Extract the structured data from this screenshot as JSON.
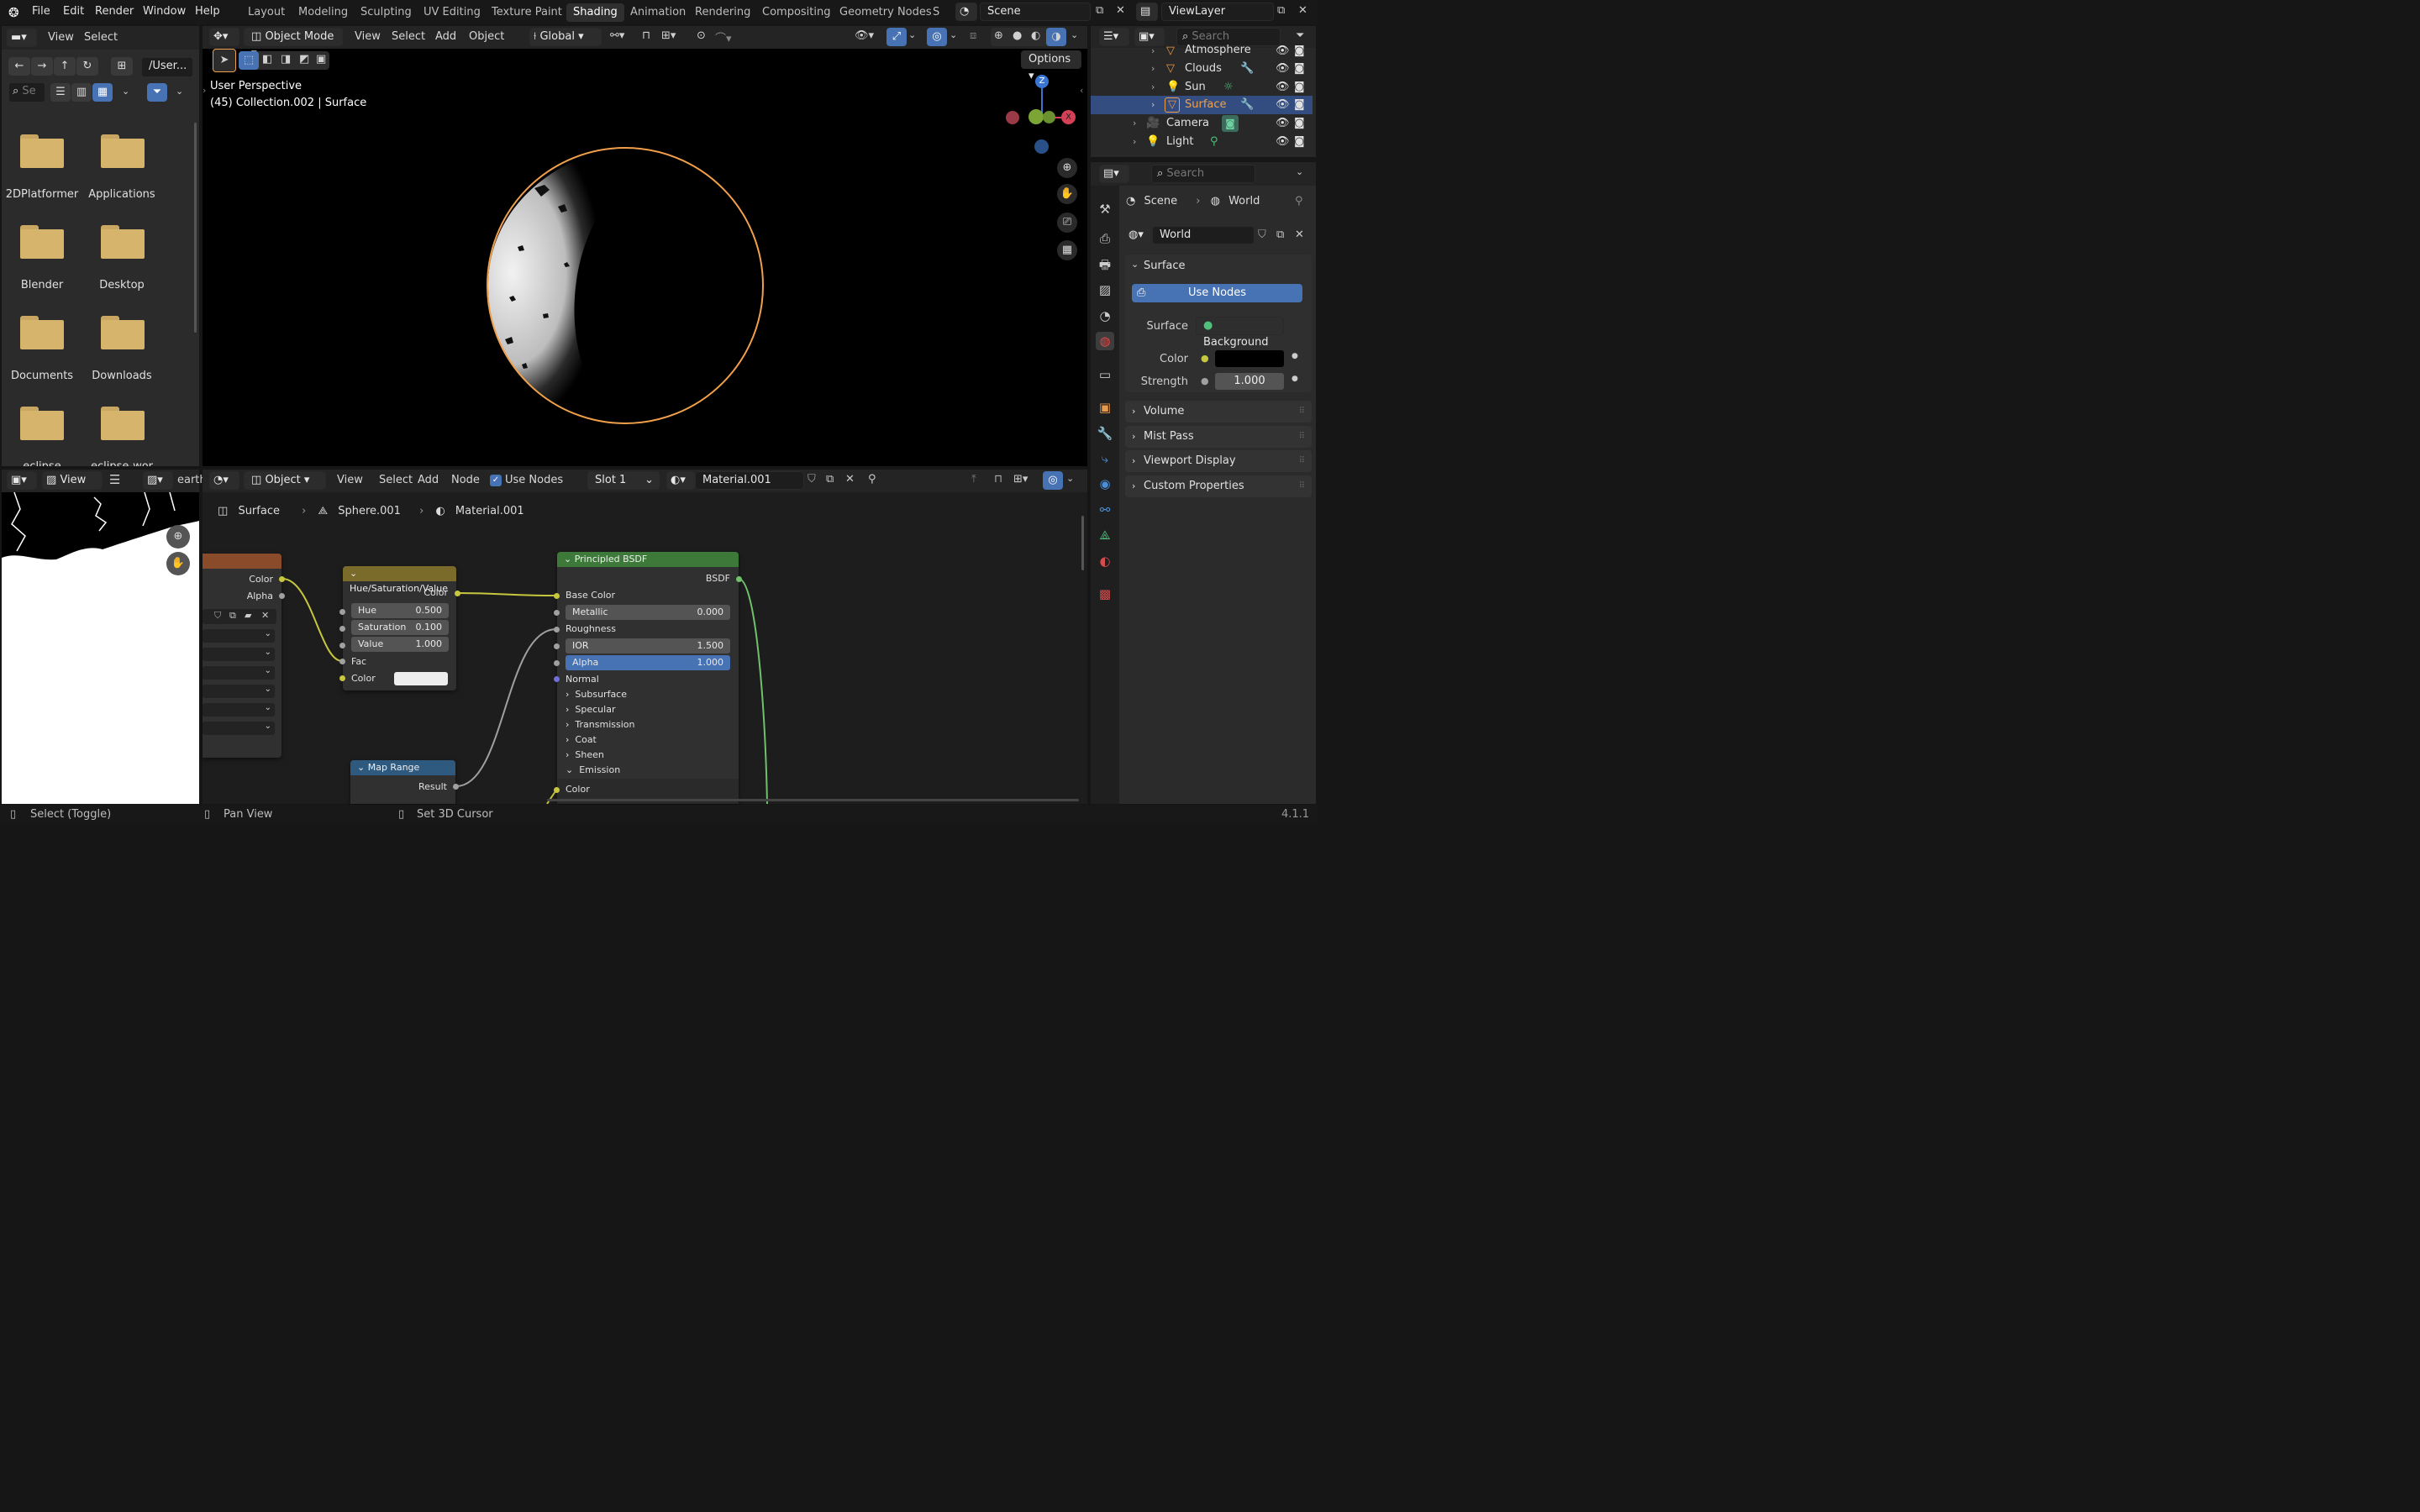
{
  "topbar": {
    "menus": [
      "File",
      "Edit",
      "Render",
      "Window",
      "Help"
    ],
    "workspaces": [
      "Layout",
      "Modeling",
      "Sculpting",
      "UV Editing",
      "Texture Paint",
      "Shading",
      "Animation",
      "Rendering",
      "Compositing",
      "Geometry Nodes",
      "S"
    ],
    "active_workspace": "Shading",
    "scene": "Scene",
    "view_layer": "ViewLayer"
  },
  "file_browser": {
    "menus": [
      "View",
      "Select"
    ],
    "path": "/User...",
    "search_placeholder": "Se",
    "folders": [
      "2DPlatformer",
      "Applications",
      "Blender",
      "Desktop",
      "Documents",
      "Downloads",
      "eclipse",
      "eclipse-wor"
    ]
  },
  "image_editor": {
    "view_label": "View",
    "image_name": "earth"
  },
  "viewport": {
    "mode": "Object Mode",
    "menus": [
      "View",
      "Select",
      "Add",
      "Object"
    ],
    "orientation": "Global",
    "options": "Options",
    "perspective": "User Perspective",
    "collection_info": "(45) Collection.002 | Surface",
    "gizmo": {
      "z": "Z",
      "x": "X"
    }
  },
  "node_editor": {
    "type": "Object",
    "menus": [
      "View",
      "Select",
      "Add",
      "Node"
    ],
    "use_nodes": "Use Nodes",
    "slot": "Slot 1",
    "material": "Material.001",
    "breadcrumb": [
      "Surface",
      "Sphere.001",
      "Material.001"
    ],
    "image_node": {
      "outputs": [
        "Color",
        "Alpha"
      ]
    },
    "hsv_node": {
      "title": "Hue/Saturation/Value",
      "output": "Color",
      "inputs": [
        {
          "label": "Hue",
          "value": "0.500"
        },
        {
          "label": "Saturation",
          "value": "0.100"
        },
        {
          "label": "Value",
          "value": "1.000"
        }
      ],
      "fac": "Fac",
      "color": "Color"
    },
    "bsdf_node": {
      "title": "Principled BSDF",
      "output": "BSDF",
      "base_color": "Base Color",
      "metallic": {
        "label": "Metallic",
        "value": "0.000"
      },
      "roughness": "Roughness",
      "ior": {
        "label": "IOR",
        "value": "1.500"
      },
      "alpha": {
        "label": "Alpha",
        "value": "1.000"
      },
      "normal": "Normal",
      "panels": [
        "Subsurface",
        "Specular",
        "Transmission",
        "Coat",
        "Sheen",
        "Emission"
      ],
      "emission_color": "Color"
    },
    "map_range_node": {
      "title": "Map Range",
      "output": "Result"
    }
  },
  "outliner": {
    "search_placeholder": "Search",
    "items": [
      {
        "name": "Atmosphere"
      },
      {
        "name": "Clouds"
      },
      {
        "name": "Sun"
      },
      {
        "name": "Surface",
        "selected": true
      },
      {
        "name": "Camera"
      },
      {
        "name": "Light"
      }
    ]
  },
  "properties": {
    "search_placeholder": "Search",
    "breadcrumb": [
      "Scene",
      "World"
    ],
    "world_name": "World",
    "surface_section": "Surface",
    "use_nodes": "Use Nodes",
    "surface_label": "Surface",
    "surface_value": "Background",
    "color_label": "Color",
    "strength_label": "Strength",
    "strength_value": "1.000",
    "sections": [
      "Volume",
      "Mist Pass",
      "Viewport Display",
      "Custom Properties"
    ]
  },
  "statusbar": {
    "items": [
      "Select (Toggle)",
      "Pan View",
      "Set 3D Cursor"
    ],
    "version": "4.1.1"
  },
  "colors": {
    "accent": "#4772b3",
    "selection_outline": "#f0a04a",
    "folder": "#d6b46c",
    "bsdf_header": "#3d7a3a",
    "hsv_header": "#7a6b2b",
    "map_range_header": "#2f5a80"
  }
}
